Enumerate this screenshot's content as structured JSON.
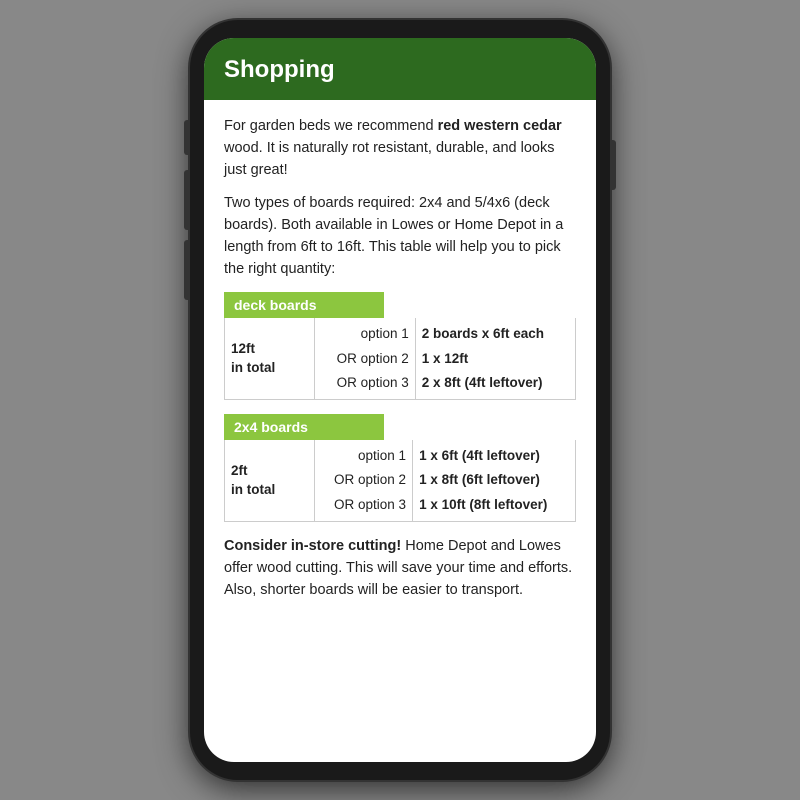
{
  "header": {
    "title": "Shopping"
  },
  "intro": {
    "paragraph1_plain": "For garden beds we recommend ",
    "paragraph1_bold": "red western cedar",
    "paragraph1_rest": " wood. It is naturally rot resistant, durable, and looks just great!",
    "paragraph2": "Two types of boards required: 2x4 and 5/4x6 (deck boards). Both available in Lowes or Home Depot in a length from 6ft to 16ft. This table will help you to pick the right quantity:"
  },
  "deck_boards": {
    "header": "deck boards",
    "row_label_line1": "12ft",
    "row_label_line2": "in total",
    "option1_label": "option 1",
    "option2_label": "OR option 2",
    "option3_label": "OR option 3",
    "option1_value": "2 boards x 6ft each",
    "option2_value": "1 x 12ft",
    "option3_value": "2 x 8ft (4ft leftover)"
  },
  "boards_2x4": {
    "header": "2x4 boards",
    "row_label_line1": "2ft",
    "row_label_line2": "in total",
    "option1_label": "option 1",
    "option2_label": "OR option 2",
    "option3_label": "OR option 3",
    "option1_value": "1 x 6ft (4ft leftover)",
    "option2_value": "1 x 8ft (6ft leftover)",
    "option3_value": "1 x 10ft (8ft leftover)"
  },
  "conclusion": {
    "bold_part": "Consider in-store cutting!",
    "rest": " Home Depot and Lowes offer wood cutting. This will save your time and efforts. Also, shorter boards will be easier to transport."
  }
}
